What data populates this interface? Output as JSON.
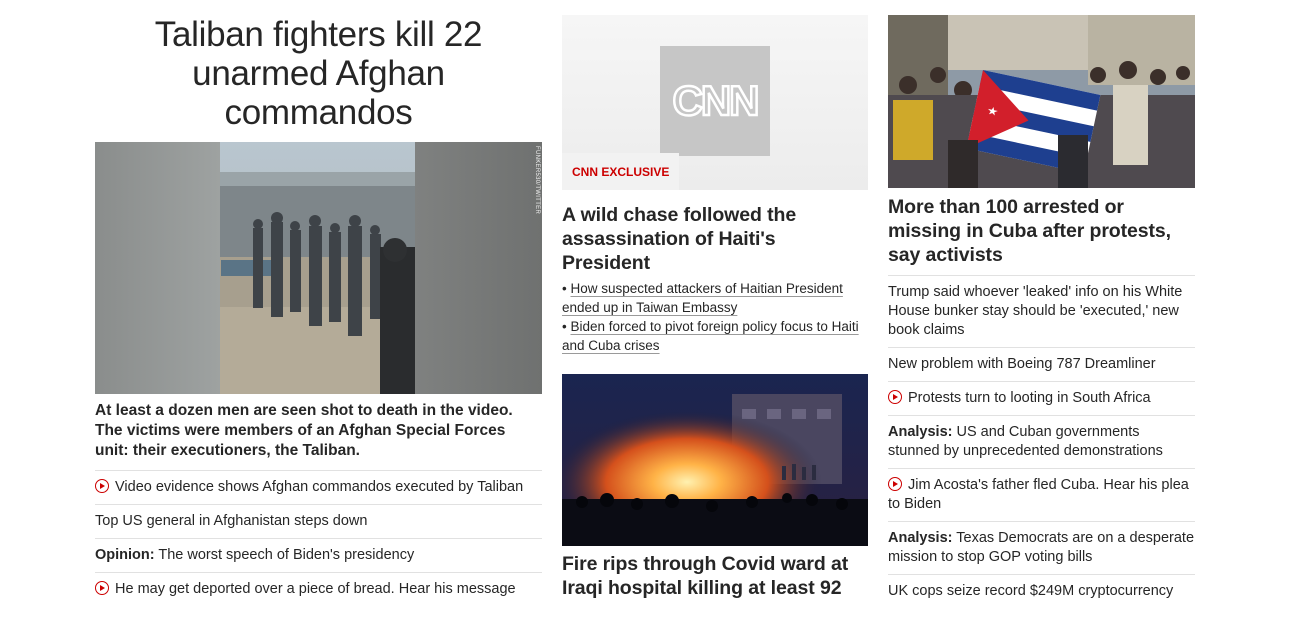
{
  "lead": {
    "title": "Taliban fighters kill 22 unarmed Afghan commandos",
    "image_credit": "FUNKER530/TWITTER",
    "description": "At least a dozen men are seen shot to death in the video. The victims were members of an Afghan Special Forces unit: their executioners, the Taliban.",
    "links": [
      {
        "prefix": "",
        "text": "Video evidence shows Afghan commandos executed by Taliban",
        "video": true
      },
      {
        "prefix": "",
        "text": "Top US general in Afghanistan steps down",
        "video": false
      },
      {
        "prefix": "Opinion:",
        "text": " The worst speech of Biden's presidency",
        "video": false
      },
      {
        "prefix": "",
        "text": "He may get deported over a piece of bread. Hear his message",
        "video": true
      }
    ]
  },
  "haiti": {
    "badge": "CNN EXCLUSIVE",
    "logo_text": "CNN",
    "title": "A wild chase followed the assassination of Haiti's President",
    "bullets": [
      "How suspected attackers of Haitian President ended up in Taiwan Embassy",
      "Biden forced to pivot foreign policy focus to Haiti and Cuba crises"
    ]
  },
  "iraq": {
    "title": "Fire rips through Covid ward at Iraqi hospital killing at least 92"
  },
  "cuba": {
    "title": "More than 100 arrested or missing in Cuba after protests, say activists",
    "links": [
      {
        "prefix": "",
        "text": "Trump said whoever 'leaked' info on his White House bunker stay should be 'executed,' new book claims",
        "video": false
      },
      {
        "prefix": "",
        "text": "New problem with Boeing 787 Dreamliner",
        "video": false
      },
      {
        "prefix": "",
        "text": "Protests turn to looting in South Africa",
        "video": true
      },
      {
        "prefix": "Analysis:",
        "text": " US and Cuban governments stunned by unprecedented demonstrations",
        "video": false
      },
      {
        "prefix": "",
        "text": "Jim Acosta's father fled Cuba. Hear his plea to Biden",
        "video": true
      },
      {
        "prefix": "Analysis:",
        "text": " Texas Democrats are on a desperate mission to stop GOP voting bills",
        "video": false
      },
      {
        "prefix": "",
        "text": "UK cops seize record $249M cryptocurrency",
        "video": false
      }
    ]
  },
  "colors": {
    "accent_red": "#cc0000",
    "text": "#262626",
    "divider": "#e1e1e1"
  }
}
